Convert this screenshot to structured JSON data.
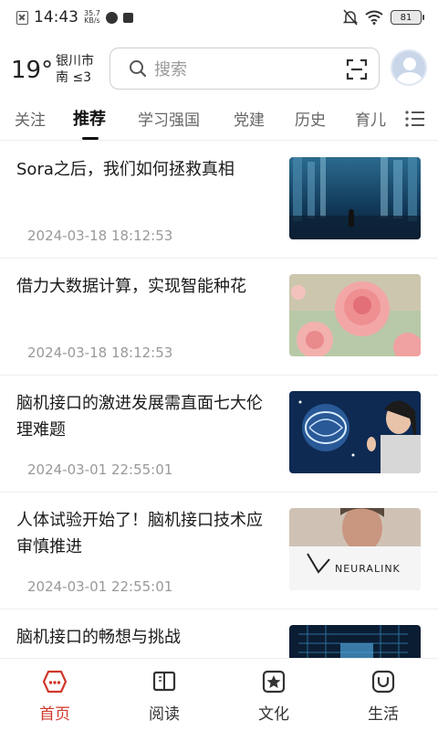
{
  "status_bar": {
    "time": "14:43",
    "net_speed_value": "35.7",
    "net_speed_unit": "KB/s",
    "battery": "81"
  },
  "header": {
    "temperature": "19°",
    "city": "银川市",
    "wind": "南 ≤3",
    "search_placeholder": "搜索"
  },
  "tabs": [
    {
      "label": "关注",
      "active": false
    },
    {
      "label": "推荐",
      "active": true
    },
    {
      "label": "学习强国",
      "active": false
    },
    {
      "label": "党建",
      "active": false
    },
    {
      "label": "历史",
      "active": false
    },
    {
      "label": "育儿",
      "active": false
    }
  ],
  "news": [
    {
      "title": "Sora之后，我们如何拯救真相",
      "date": "2024-03-18 18:12:53",
      "thumb": "city-figure-image"
    },
    {
      "title": "借力大数据计算，实现智能种花",
      "date": "2024-03-18 18:12:53",
      "thumb": "rose-image"
    },
    {
      "title": "脑机接口的激进发展需直面七大伦理难题",
      "date": "2024-03-01 22:55:01",
      "thumb": "brain-woman-image"
    },
    {
      "title": "人体试验开始了！脑机接口技术应审慎推进",
      "date": "2024-03-01 22:55:01",
      "thumb": "neuralink-image"
    },
    {
      "title": "脑机接口的畅想与挑战",
      "date": "",
      "thumb": "circuit-image"
    }
  ],
  "neuralink_text": "NEURALINK",
  "bottom_nav": [
    {
      "label": "首页",
      "icon": "home-icon",
      "active": true
    },
    {
      "label": "阅读",
      "icon": "book-icon",
      "active": false
    },
    {
      "label": "文化",
      "icon": "star-icon",
      "active": false
    },
    {
      "label": "生活",
      "icon": "life-icon",
      "active": false
    }
  ],
  "colors": {
    "accent": "#d0382b",
    "text": "#1a1a1a",
    "muted": "#999999"
  }
}
